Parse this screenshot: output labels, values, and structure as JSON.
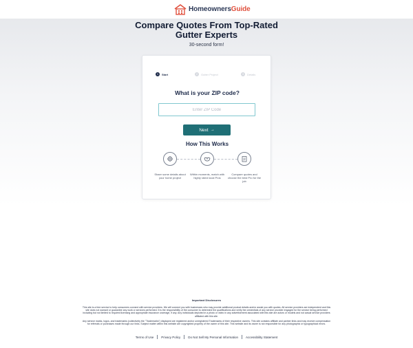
{
  "header": {
    "logo_text_main": "Homeowners",
    "logo_text_accent": "Guide",
    "logo_icon": "house-icon",
    "accent_color": "#e0513e",
    "brand_color": "#2c3957"
  },
  "hero": {
    "title_line1": "Compare Quotes From Top-Rated",
    "title_line2": "Gutter Experts",
    "subtitle": "30-second form!"
  },
  "form": {
    "steps": [
      {
        "num": "1",
        "label": "Start",
        "active": true
      },
      {
        "num": "2",
        "label": "Gutter Project",
        "active": false
      },
      {
        "num": "3",
        "label": "Details",
        "active": false
      }
    ],
    "question": "What is your ZIP code?",
    "zip_value": "",
    "zip_placeholder": "Enter ZIP Code",
    "next_label": "Next",
    "next_icon": "arrow-right-icon",
    "button_color": "#1f6f76"
  },
  "how": {
    "title": "How This Works",
    "items": [
      {
        "icon": "wrench-icon",
        "text": "Share some details about your home project"
      },
      {
        "icon": "handshake-icon",
        "text": "Within moments, match with highly rated local Pros"
      },
      {
        "icon": "clipboard-icon",
        "text": "Compare quotes and choose the best Pro for the job"
      }
    ]
  },
  "disclosures": {
    "title": "Important Disclosures",
    "paragraph1": "This site is a free service to help consumers connect with service providers. We will connect you with businesses who may provide additional product details and/or assist you with quotes. All service providers are independent and this site does not warrant or guarantee any work or services performed. It is the responsibility of the consumer to determine the qualifications and verify the credentials of any service provider engaged for the service being performed including but not limited to required licensing and appropriate insurance coverage, if any. Any individuals depicted in a photo or video in any advertisement associated with this site are actors or models and not actual service providers affiliated with this site.",
    "paragraph2": "Any service marks, logos, and trademarks (collectively the \"Trademarks\") displayed are registered and/or unregistered Trademarks of their respective owners. This site contains affiliate and partner links and may receive compensation for referrals or purchases made through our links. Subject matter within this website are copyrighted property of the owner of this site. This website and its owner is not responsible for any photographic or typographical errors."
  },
  "footer": {
    "links": [
      "Terms of Use",
      "Privacy Policy",
      "Do Not Sell My Personal Information",
      "Accessibility Statement"
    ]
  }
}
